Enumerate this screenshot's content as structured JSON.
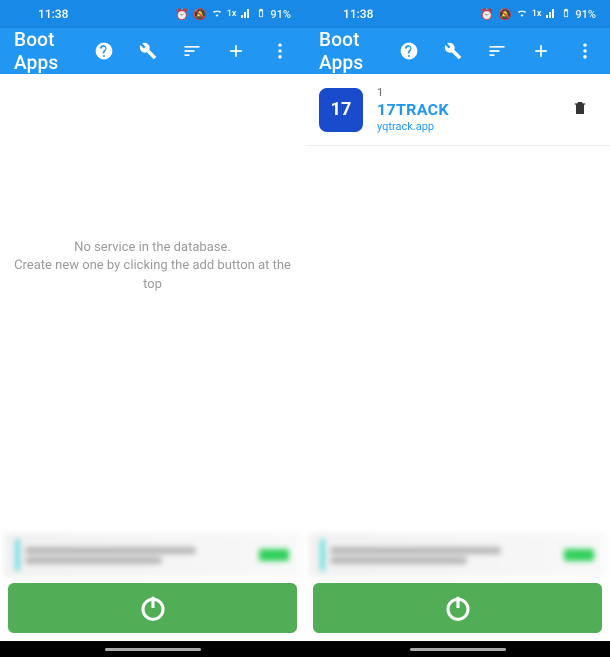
{
  "status": {
    "time": "11:38",
    "battery": "91%"
  },
  "app_bar": {
    "title": "Boot Apps"
  },
  "screen_a": {
    "empty_title": "No service in the database.",
    "empty_sub": "Create new one by clicking the add button at the top"
  },
  "screen_b": {
    "item": {
      "index": "1",
      "icon_text": "17",
      "name": "17TRACK",
      "package": "yqtrack.app"
    }
  }
}
